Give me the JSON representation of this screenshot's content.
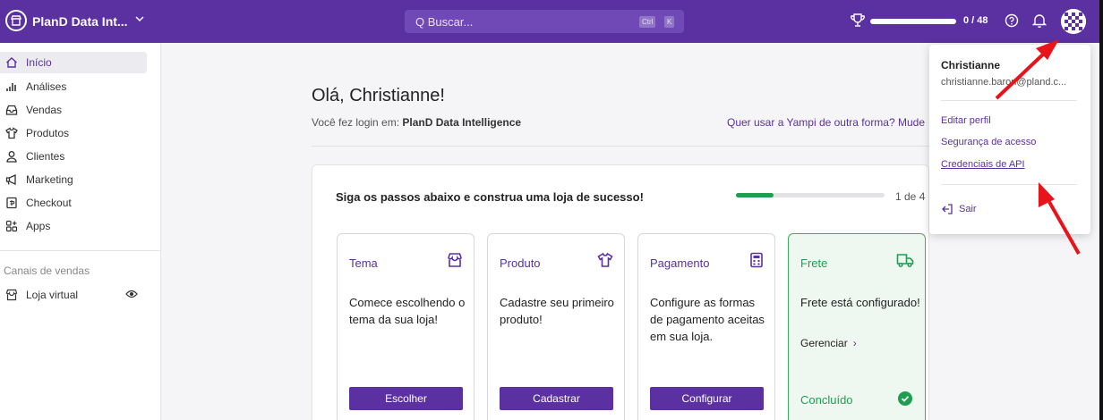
{
  "header": {
    "store_name": "PlanD Data Int...",
    "search_placeholder": "Q Buscar...",
    "kbd_ctrl": "Ctrl",
    "kbd_k": "K",
    "progress_value": 0,
    "progress_label": "0 / 48"
  },
  "sidebar": {
    "items": [
      {
        "label": "Início",
        "icon": "home-icon",
        "active": true
      },
      {
        "label": "Análises",
        "icon": "chart-icon"
      },
      {
        "label": "Vendas",
        "icon": "inbox-icon"
      },
      {
        "label": "Produtos",
        "icon": "shirt-icon"
      },
      {
        "label": "Clientes",
        "icon": "user-icon"
      },
      {
        "label": "Marketing",
        "icon": "megaphone-icon"
      },
      {
        "label": "Checkout",
        "icon": "checkout-icon"
      },
      {
        "label": "Apps",
        "icon": "apps-icon"
      }
    ],
    "section_label": "Canais de vendas",
    "channel": {
      "label": "Loja virtual",
      "icon": "store-icon"
    }
  },
  "main": {
    "greeting": "Olá, Christianne!",
    "login_prefix": "Você fez login em:",
    "login_store": "PlanD Data Intelligence",
    "other_way_link": "Quer usar a Yampi de outra forma? Mude",
    "steps": {
      "title": "Siga os passos abaixo e construa uma loja de sucesso!",
      "progress_fraction": 0.25,
      "count": "1 de 4",
      "cards": [
        {
          "title": "Tema",
          "desc": "Comece escolhendo o tema da sua loja!",
          "button": "Escolher",
          "icon": "store-icon"
        },
        {
          "title": "Produto",
          "desc": "Cadastre seu primeiro produto!",
          "button": "Cadastrar",
          "icon": "shirt-icon"
        },
        {
          "title": "Pagamento",
          "desc": "Configure as formas de pagamento aceitas em sua loja.",
          "button": "Configurar",
          "icon": "calculator-icon"
        },
        {
          "title": "Frete",
          "desc": "Frete está configurado!",
          "manage": "Gerenciar",
          "done_label": "Concluído",
          "icon": "truck-icon"
        }
      ]
    }
  },
  "dropdown": {
    "name": "Christianne",
    "email": "christianne.baron@pland.c...",
    "links": [
      "Editar perfil",
      "Segurança de acesso",
      "Credenciais de API"
    ],
    "logout": "Sair"
  },
  "colors": {
    "brand": "#5b30a0",
    "success": "#1e9f50",
    "annotation": "#e8141c"
  }
}
